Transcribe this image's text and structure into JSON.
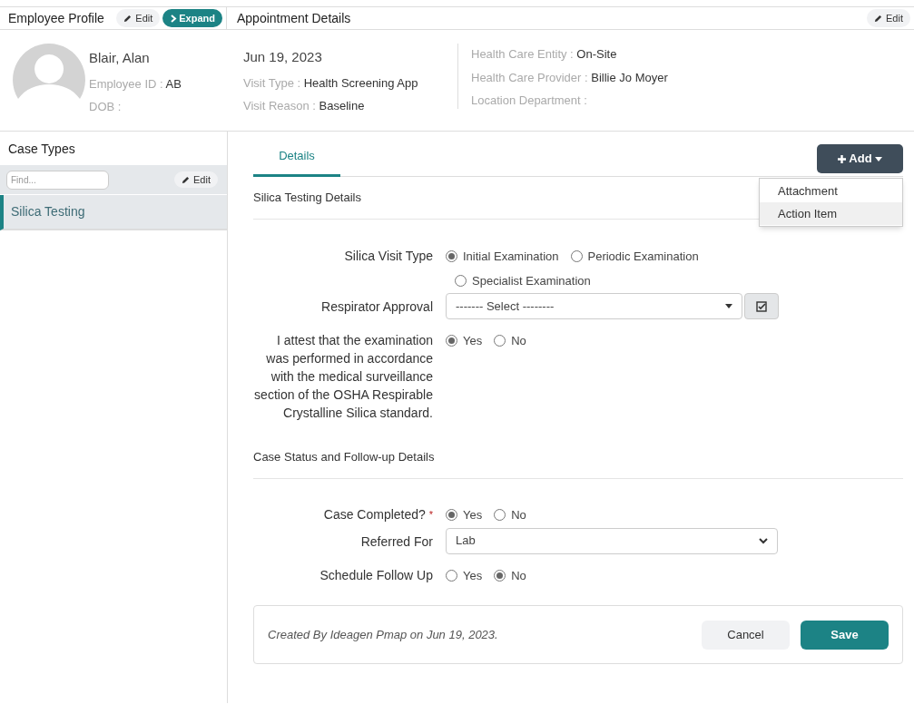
{
  "employee_profile": {
    "title": "Employee Profile",
    "edit_button": "Edit",
    "expand_button": "Expand",
    "name": "Blair, Alan",
    "fields": [
      {
        "label": "Employee ID :",
        "value": "AB"
      },
      {
        "label": "DOB :"
      }
    ]
  },
  "appointment_details": {
    "title": "Appointment Details",
    "edit_button": "Edit",
    "date": "Jun 19, 2023",
    "fields": [
      {
        "label": "Visit Type :",
        "value": "Health Screening App"
      },
      {
        "label": "Visit Reason :",
        "value": "Baseline"
      }
    ],
    "fields_right": [
      {
        "label": "Health Care Entity :",
        "value": "On-Site"
      },
      {
        "label": "Health Care Provider :",
        "value": "Billie Jo Moyer"
      },
      {
        "label": "Location Department :"
      }
    ]
  },
  "case_types": {
    "title": "Case Types",
    "search": {
      "placeholder": "Find..."
    },
    "edit_button": "Edit",
    "items": [
      {
        "label": "Silica Testing",
        "selected": true
      }
    ]
  },
  "tabs": [
    {
      "label": "Details",
      "selected": true
    }
  ],
  "add_button": "Add",
  "add_menu": {
    "items": [
      {
        "label": "Attachment",
        "highlighted": false
      },
      {
        "label": "Action Item",
        "highlighted": true
      }
    ]
  },
  "sections": [
    {
      "title": "Silica Testing Details",
      "fields": [
        {
          "kind": "radio",
          "label": "Silica Visit Type",
          "options": [
            {
              "label": "Initial Examination",
              "selected": true
            },
            {
              "label": "Periodic Examination",
              "selected": false
            },
            {
              "label": "Specialist Examination",
              "selected": false
            }
          ]
        },
        {
          "kind": "select",
          "label": "Respirator Approval",
          "value": "------- Select --------",
          "addon_button": true
        },
        {
          "kind": "radio",
          "label": "I attest that the examination was performed in accordance with the medical surveillance section of the OSHA Respirable Crystalline Silica standard.",
          "options": [
            {
              "label": "Yes",
              "selected": true
            },
            {
              "label": "No",
              "selected": false
            }
          ]
        }
      ]
    },
    {
      "title": "Case Status and Follow-up Details",
      "fields": [
        {
          "kind": "radio",
          "label": "Case Completed?",
          "required_mark": "*",
          "options": [
            {
              "label": "Yes",
              "selected": true
            },
            {
              "label": "No",
              "selected": false
            }
          ]
        },
        {
          "kind": "select",
          "label": "Referred For",
          "value": "Lab",
          "addon_button": false
        },
        {
          "kind": "radio",
          "label": "Schedule Follow Up",
          "options": [
            {
              "label": "Yes",
              "selected": false
            },
            {
              "label": "No",
              "selected": true
            }
          ]
        }
      ]
    }
  ],
  "footer": {
    "created_text": "Created By Ideagen Pmap on Jun 19, 2023.",
    "buttons": [
      {
        "label": "Cancel",
        "kind": "secondary"
      },
      {
        "label": "Save",
        "kind": "primary"
      }
    ]
  }
}
